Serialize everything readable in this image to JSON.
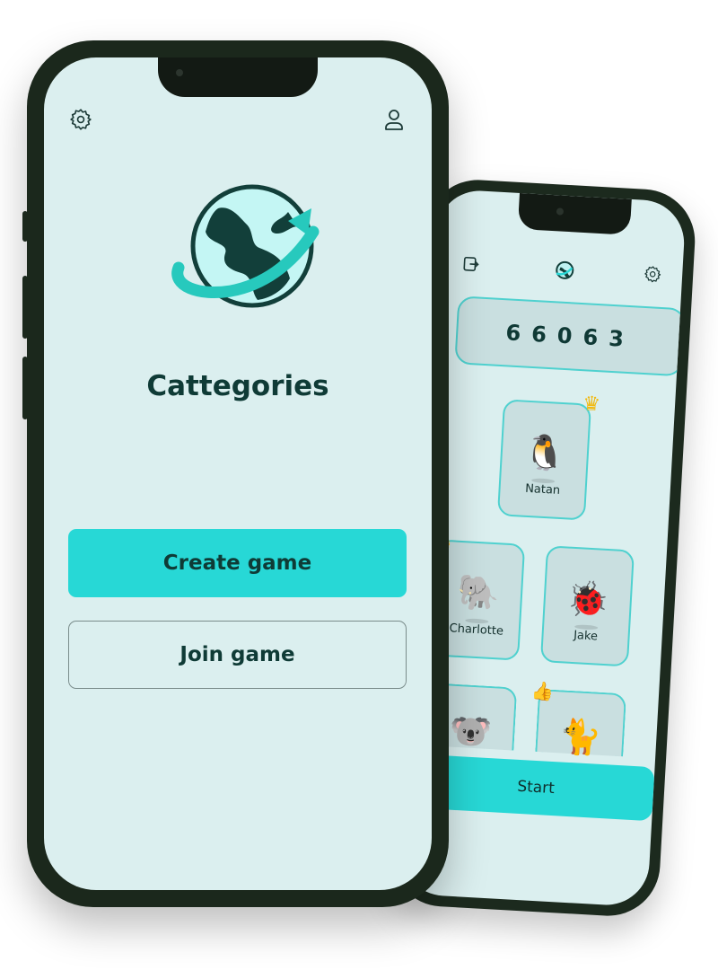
{
  "colors": {
    "screen_bg": "#dbefef",
    "accent": "#27d8d6",
    "text_dark": "#0f3b36",
    "card_bg": "#c9dfe0",
    "card_border": "#4fd1cf",
    "crown": "#f1b90f"
  },
  "front": {
    "title": "Cattegories",
    "create_label": "Create game",
    "join_label": "Join game",
    "icons": {
      "settings": "gear-icon",
      "profile": "user-icon",
      "logo": "globe-logo-icon"
    }
  },
  "back": {
    "room_code": "66063",
    "icons": {
      "exit": "exit-icon",
      "globe": "globe-icon",
      "settings": "gear-icon"
    },
    "players": [
      {
        "name": "Natan",
        "avatar": "penguin-icon",
        "emoji": "🐧",
        "badge": "crown-icon"
      },
      {
        "name": "Charlotte",
        "avatar": "elephant-icon",
        "emoji": "🐘",
        "badge": "thumbs-up-icon"
      },
      {
        "name": "Jake",
        "avatar": "ladybug-icon",
        "emoji": "🐞",
        "badge": ""
      },
      {
        "name": "",
        "avatar": "koala-icon",
        "emoji": "🐨",
        "badge": "thumbs-up-icon"
      },
      {
        "name": "",
        "avatar": "cat-icon",
        "emoji": "🐈",
        "badge": "thumbs-up-icon"
      }
    ],
    "start_label": "Start"
  }
}
